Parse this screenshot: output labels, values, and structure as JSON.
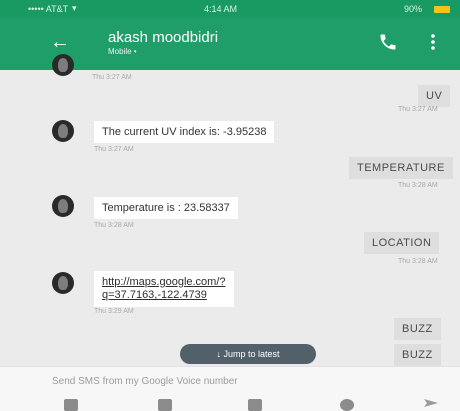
{
  "status_bar": {
    "carrier": "••••• AT&T",
    "wifi": "▾",
    "time": "4:14 AM",
    "battery": "90%"
  },
  "app_bar": {
    "back": "←",
    "contact_name": "akash moodbidri",
    "contact_sub": "Mobile •"
  },
  "conversation": {
    "ts0": "Thu 3:27 AM",
    "m1": "UV",
    "ts1": "Thu 3:27 AM",
    "m2": "The current UV index is: -3.95238",
    "ts2": "Thu 3:27 AM",
    "m3": "TEMPERATURE",
    "ts3": "Thu 3:28 AM",
    "m4": "Temperature is : 23.58337",
    "ts4": "Thu 3:28 AM",
    "m5": "LOCATION",
    "ts5": "Thu 3:28 AM",
    "m6_line1": "http://maps.google.com/?",
    "m6_line2": "q=37.7163,-122.4739",
    "ts6": "Thu 3:29 AM",
    "m7": "BUZZ",
    "m8": "BUZZ"
  },
  "jump": "↓ Jump to latest",
  "composer": {
    "placeholder": "Send SMS from my Google Voice number"
  },
  "colors": {
    "app_bar": "#1f9e69",
    "status_bar": "#1a9a63",
    "battery": "#f3c21c"
  }
}
